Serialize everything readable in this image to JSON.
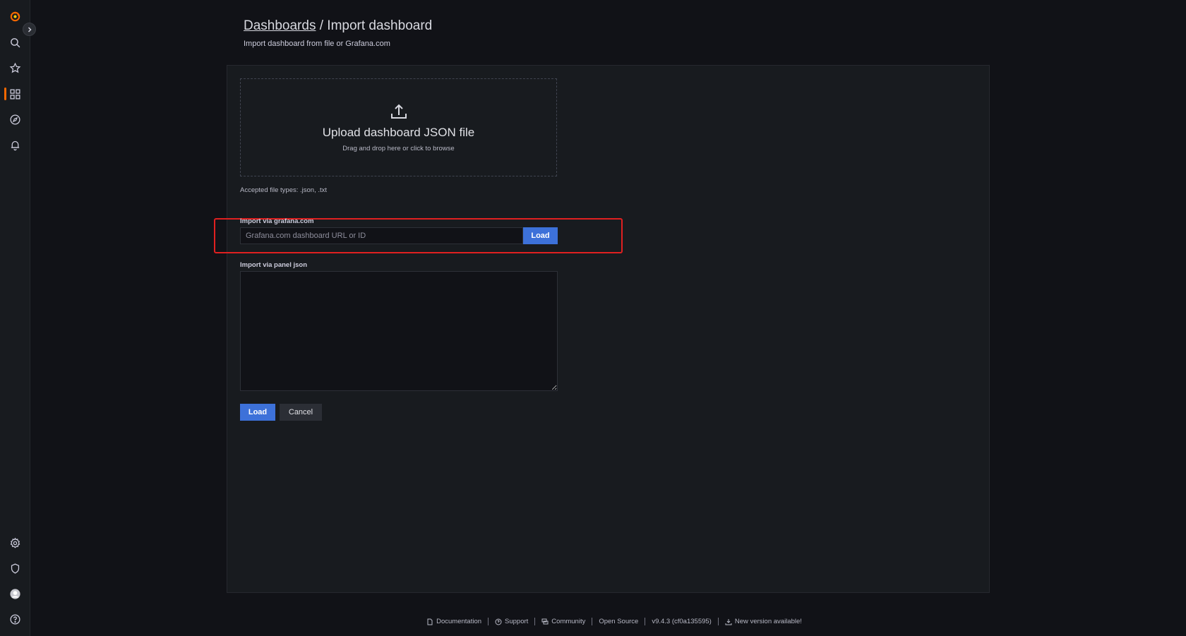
{
  "breadcrumb": {
    "parent": "Dashboards",
    "separator": " / ",
    "current": "Import dashboard"
  },
  "subtitle": "Import dashboard from file or Grafana.com",
  "upload": {
    "title": "Upload dashboard JSON file",
    "hint": "Drag and drop here or click to browse",
    "accepted": "Accepted file types: .json, .txt"
  },
  "grafana_import": {
    "label": "Import via grafana.com",
    "placeholder": "Grafana.com dashboard URL or ID",
    "value": "",
    "load_label": "Load"
  },
  "panel_json": {
    "label": "Import via panel json",
    "value": ""
  },
  "actions": {
    "load": "Load",
    "cancel": "Cancel"
  },
  "footer": {
    "documentation": "Documentation",
    "support": "Support",
    "community": "Community",
    "open_source": "Open Source",
    "version": "v9.4.3 (cf0a135595)",
    "new_version": "New version available!"
  },
  "colors": {
    "accent": "#f46800",
    "primary_button": "#3d71d9",
    "highlight": "#e02020",
    "background": "#111217",
    "panel": "#181b1f"
  },
  "icons": [
    "grafana-logo-icon",
    "search-icon",
    "star-icon",
    "dashboards-icon",
    "explore-icon",
    "alerting-icon",
    "gear-icon",
    "shield-icon",
    "avatar",
    "help-icon",
    "upload-icon",
    "chevron-right-icon"
  ]
}
